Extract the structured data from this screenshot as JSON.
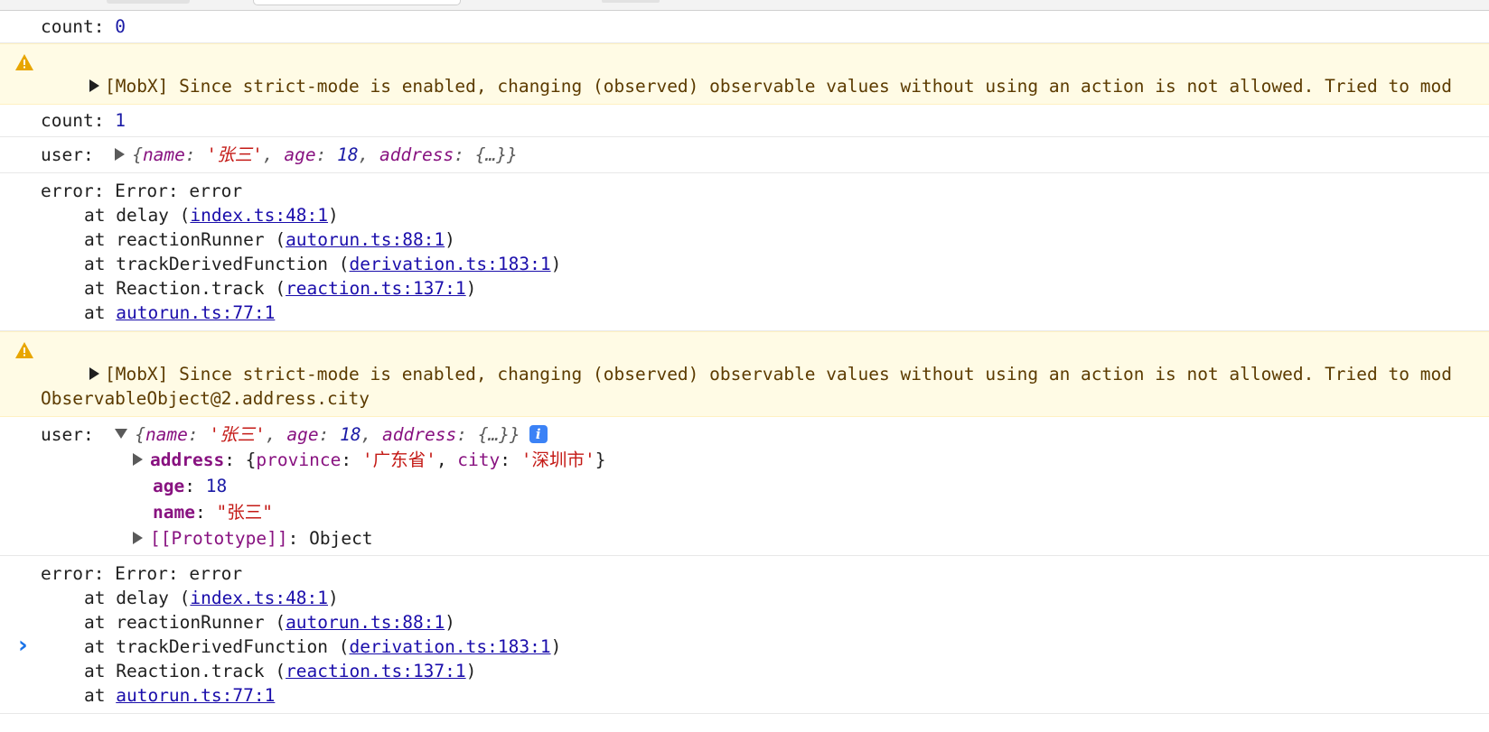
{
  "console": {
    "log_count0_label": "count: ",
    "log_count0_value": "0",
    "warning_text": "[MobX] Since strict-mode is enabled, changing (observed) observable values without using an action is not allowed. Tried to mod",
    "warning2_line2": "ObservableObject@2.address.city",
    "log_count1_label": "count: ",
    "log_count1_value": "1",
    "user_label": "user:",
    "user_preview": {
      "open": "{",
      "name_key": "name",
      "name_val": "'张三'",
      "age_key": "age",
      "age_val": "18",
      "address_key": "address",
      "address_val": "{…}",
      "close": "}"
    },
    "error_head": "error: Error: error",
    "stack": [
      {
        "prefix": "at delay (",
        "link": "index.ts:48:1",
        "suffix": ")"
      },
      {
        "prefix": "at reactionRunner (",
        "link": "autorun.ts:88:1",
        "suffix": ")"
      },
      {
        "prefix": "at trackDerivedFunction (",
        "link": "derivation.ts:183:1",
        "suffix": ")"
      },
      {
        "prefix": "at Reaction.track (",
        "link": "reaction.ts:137:1",
        "suffix": ")"
      },
      {
        "prefix": "at ",
        "link": "autorun.ts:77:1",
        "suffix": ""
      }
    ],
    "expanded": {
      "address_key": "address",
      "address_preview": "{province: '广东省', city: '深圳市'}",
      "province_key": "province",
      "province_val": "'广东省'",
      "city_key": "city",
      "city_val": "'深圳市'",
      "age_key": "age",
      "age_val": "18",
      "name_key": "name",
      "name_val": "\"张三\"",
      "proto_key": "[[Prototype]]",
      "proto_val": "Object",
      "info_badge": "i"
    },
    "prompt_symbol": "›"
  },
  "colors": {
    "warning_bg": "#fffbe5",
    "link": "#1a0dab",
    "number": "#1a1aa6",
    "property": "#881280",
    "string": "#c41a16",
    "prompt": "#1a73e8"
  }
}
